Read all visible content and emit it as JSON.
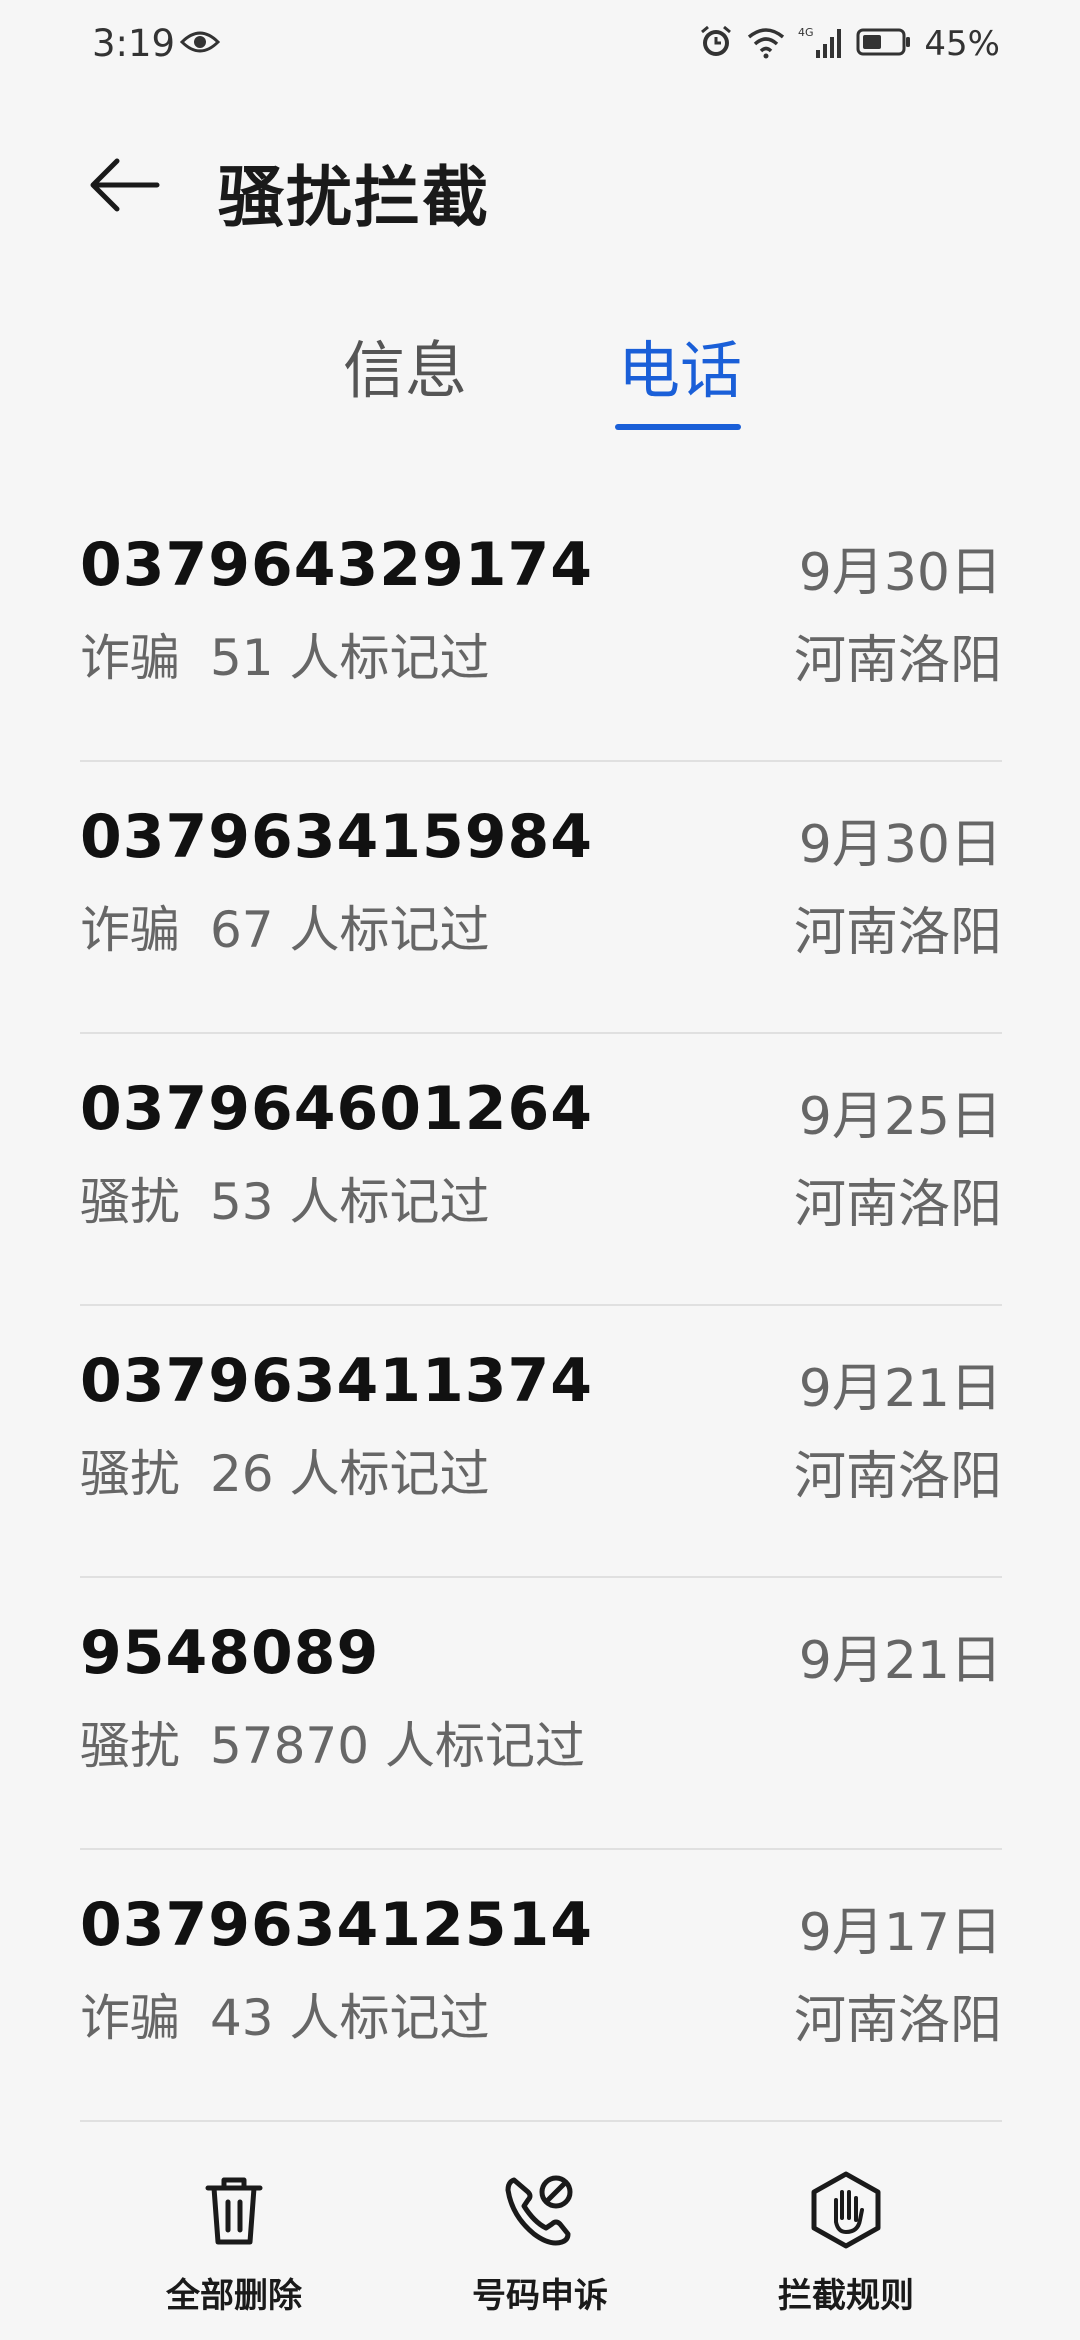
{
  "status_bar": {
    "time": "3:19",
    "network": "4G",
    "battery": "45%"
  },
  "header": {
    "title": "骚扰拦截"
  },
  "tabs": [
    {
      "label": "信息",
      "active": false
    },
    {
      "label": "电话",
      "active": true
    }
  ],
  "calls": [
    {
      "number": "037964329174",
      "type": "诈骗",
      "count": "51 人标记过",
      "date": "9月30日",
      "location": "河南洛阳"
    },
    {
      "number": "037963415984",
      "type": "诈骗",
      "count": "67 人标记过",
      "date": "9月30日",
      "location": "河南洛阳"
    },
    {
      "number": "037964601264",
      "type": "骚扰",
      "count": "53 人标记过",
      "date": "9月25日",
      "location": "河南洛阳"
    },
    {
      "number": "037963411374",
      "type": "骚扰",
      "count": "26 人标记过",
      "date": "9月21日",
      "location": "河南洛阳"
    },
    {
      "number": "9548089",
      "type": "骚扰",
      "count": "57870 人标记过",
      "date": "9月21日",
      "location": ""
    },
    {
      "number": "037963412514",
      "type": "诈骗",
      "count": "43 人标记过",
      "date": "9月17日",
      "location": "河南洛阳"
    }
  ],
  "bottom_bar": {
    "delete_all": "全部删除",
    "appeal": "号码申诉",
    "rules": "拦截规则"
  },
  "colors": {
    "accent": "#1a5fd8",
    "background": "#f6f6f6"
  }
}
